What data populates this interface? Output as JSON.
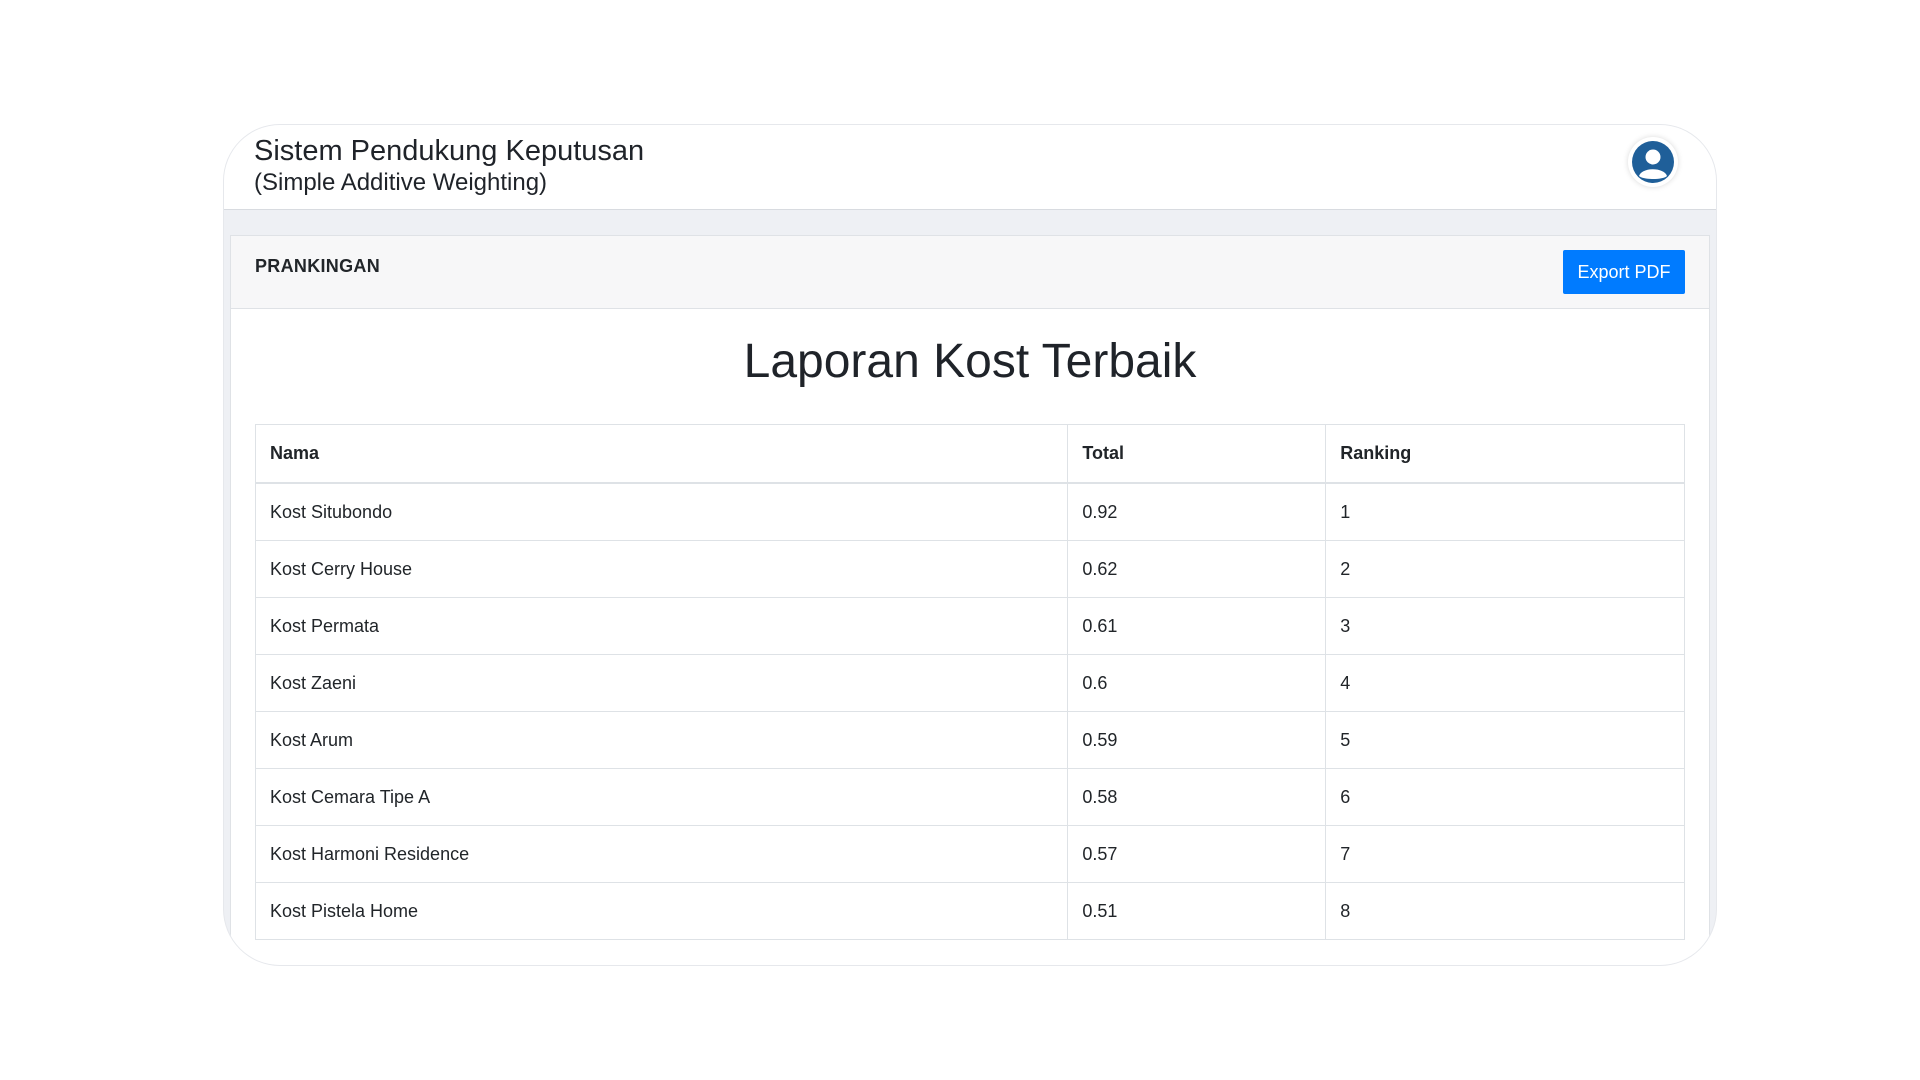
{
  "header": {
    "title": "Sistem Pendukung Keputusan",
    "subtitle": "(Simple Additive Weighting)",
    "avatar_icon": "user-avatar-icon",
    "avatar_color": "#1f5f99"
  },
  "card": {
    "header_title": "PRANKINGAN",
    "export_label": "Export PDF",
    "export_color": "#007bff"
  },
  "report": {
    "title": "Laporan Kost Terbaik"
  },
  "table": {
    "columns": [
      "Nama",
      "Total",
      "Ranking"
    ],
    "rows": [
      [
        "Kost Situbondo",
        "0.92",
        "1"
      ],
      [
        "Kost Cerry House",
        "0.62",
        "2"
      ],
      [
        "Kost Permata",
        "0.61",
        "3"
      ],
      [
        "Kost Zaeni",
        "0.6",
        "4"
      ],
      [
        "Kost Arum",
        "0.59",
        "5"
      ],
      [
        "Kost Cemara Tipe A",
        "0.58",
        "6"
      ],
      [
        "Kost Harmoni Residence",
        "0.57",
        "7"
      ],
      [
        "Kost Pistela Home",
        "0.51",
        "8"
      ]
    ]
  }
}
